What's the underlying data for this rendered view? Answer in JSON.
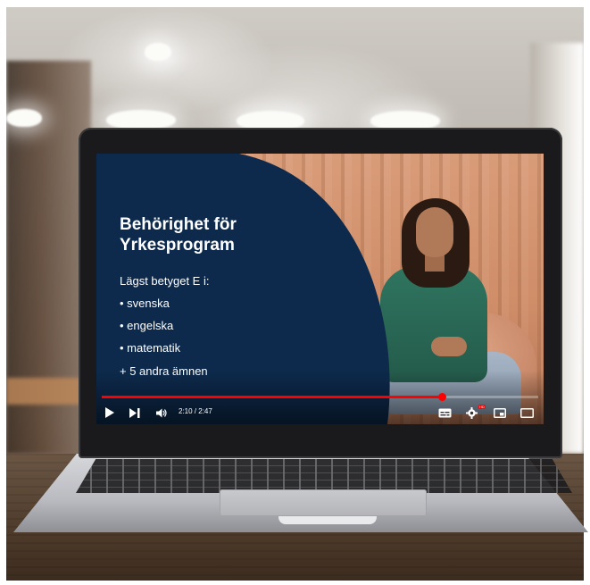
{
  "slide": {
    "title": "Behörighet för Yrkesprogram",
    "subtitle": "Lägst betyget E i:",
    "items": [
      "svenska",
      "engelska",
      "matematik"
    ],
    "extra": "+ 5 andra ämnen"
  },
  "player": {
    "time_display": "2:10 / 2:47",
    "progress": 0.78,
    "accent_color": "#ff0000",
    "hd_badge": "HD",
    "icons": [
      "play-icon",
      "next-icon",
      "volume-icon",
      "subtitles-icon",
      "settings-icon",
      "miniplayer-icon",
      "theater-icon"
    ]
  }
}
